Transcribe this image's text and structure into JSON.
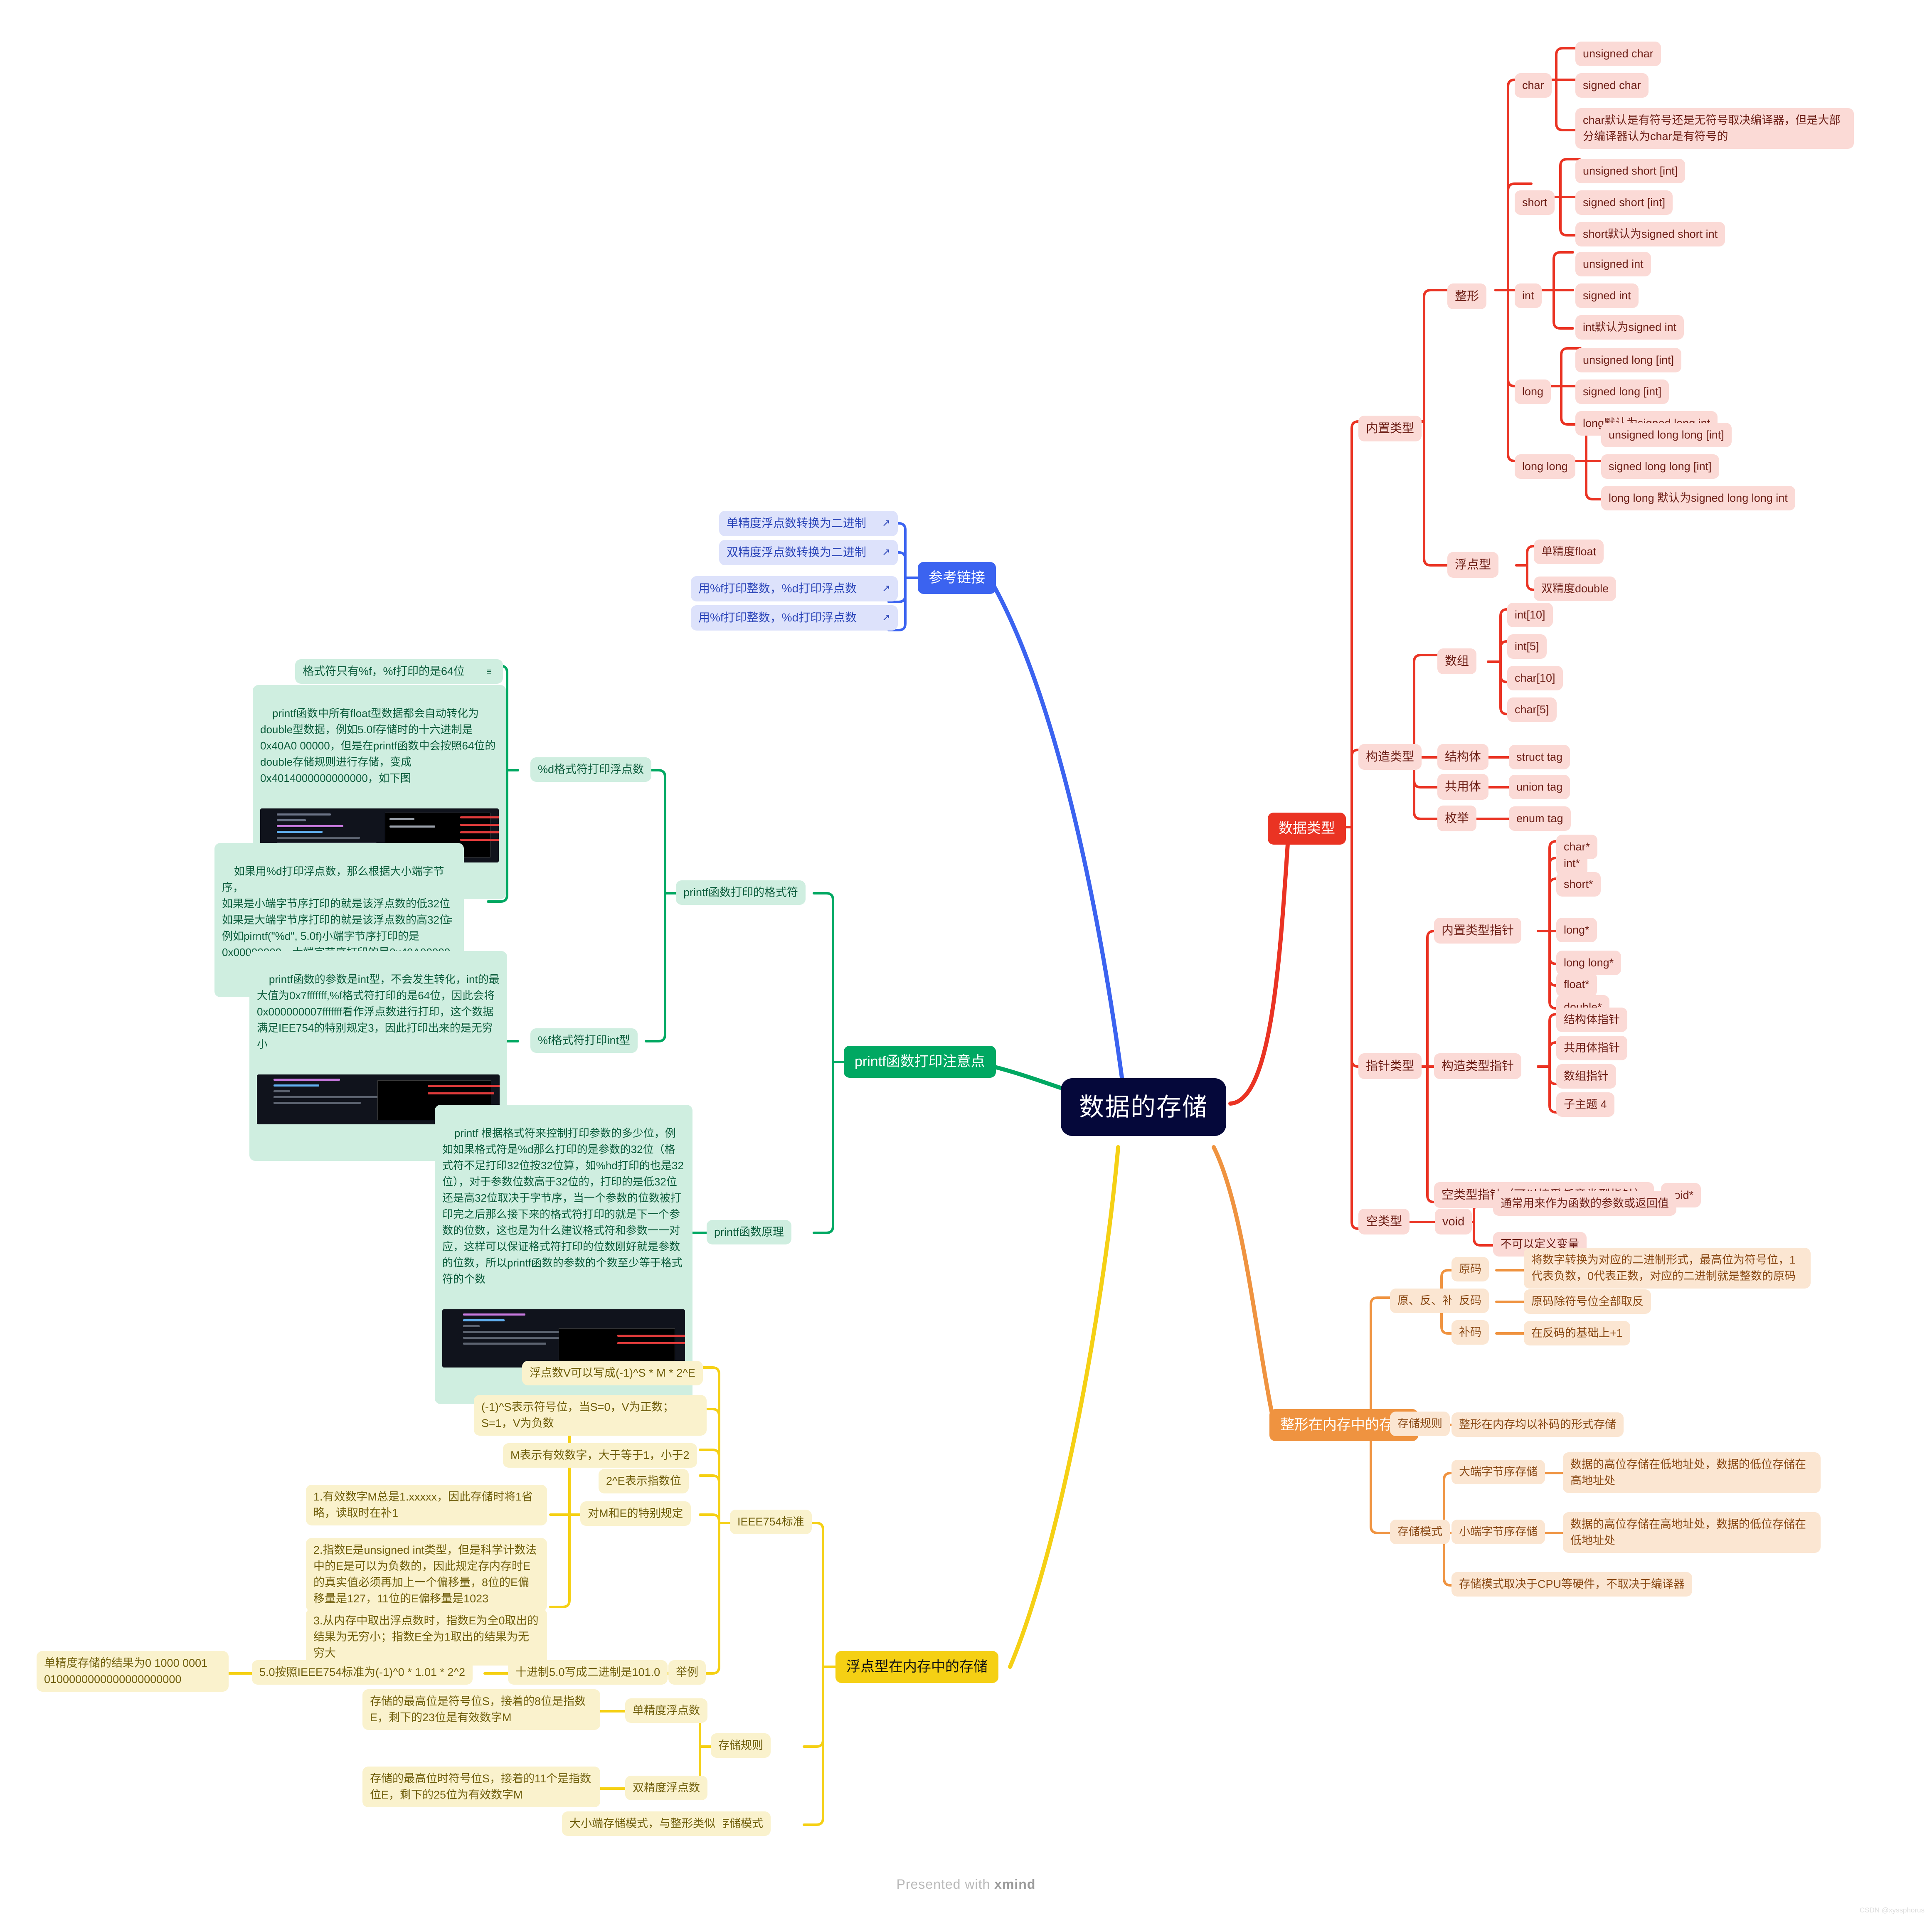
{
  "root": {
    "label": "数据的存储"
  },
  "branches": {
    "data_types": {
      "label": "数据类型",
      "color": "#ea3323",
      "children": {
        "builtin": {
          "label": "内置类型",
          "integer": {
            "label": "整形",
            "char": {
              "label": "char",
              "items": [
                "unsigned char",
                "signed char",
                "char默认是有符号还是无符号取决编译器，但是大部分编译器认为char是有符号的"
              ]
            },
            "short": {
              "label": "short",
              "items": [
                "unsigned short [int]",
                "signed short [int]",
                "short默认为signed short int"
              ]
            },
            "int": {
              "label": "int",
              "items": [
                "unsigned int",
                "signed int",
                "int默认为signed int"
              ]
            },
            "long": {
              "label": "long",
              "items": [
                "unsigned long [int]",
                "signed long [int]",
                "long默认为signed long int"
              ]
            },
            "long_long": {
              "label": "long long",
              "items": [
                "unsigned long long [int]",
                "signed long long [int]",
                "long long 默认为signed long long int"
              ]
            }
          },
          "float_type": {
            "label": "浮点型",
            "items": [
              "单精度float",
              "双精度double"
            ]
          }
        },
        "construct": {
          "label": "构造类型",
          "array": {
            "label": "数组",
            "items": [
              "int[10]",
              "int[5]",
              "char[10]",
              "char[5]"
            ]
          },
          "struct": {
            "label": "结构体",
            "item": "struct tag"
          },
          "union": {
            "label": "共用体",
            "item": "union tag"
          },
          "enum": {
            "label": "枚举",
            "item": "enum tag"
          }
        },
        "pointer": {
          "label": "指针类型",
          "builtin_ptr": {
            "label": "内置类型指针",
            "items": [
              "char*",
              "int*",
              "short*",
              "long*",
              "long long*",
              "float*",
              "double*"
            ]
          },
          "construct_ptr": {
            "label": "构造类型指针",
            "items": [
              "结构体指针",
              "共用体指针",
              "数组指针",
              "子主题 4"
            ]
          },
          "void_ptr": {
            "label": "空类型指针（可以接受任意类型指针）",
            "item": "void*"
          }
        },
        "void_type": {
          "label": "空类型",
          "void": {
            "label": "void",
            "items": [
              "通常用来作为函数的参数或返回值",
              "不可以定义变量"
            ]
          }
        }
      }
    },
    "reference_links": {
      "label": "参考链接",
      "color": "#3b63f0",
      "icon": "external-link-icon",
      "items": [
        "单精度浮点数转换为二进制",
        "双精度浮点数转换为二进制",
        "用%f打印整数，%d打印浮点数",
        "用%f打印整数，%d打印浮点数"
      ]
    },
    "printf_notes": {
      "label": "printf函数打印注意点",
      "color": "#00a862",
      "format_spec": {
        "label": "printf函数打印的格式符",
        "d_float": {
          "label": "%d格式符打印浮点数",
          "notes": [
            "格式符只有%f，%f打印的是64位",
            "printf函数中所有float型数据都会自动转化为double型数据，例如5.0f存储时的十六进制是0x40A0 00000，但是在printf函数中会按照64位的double存储规则进行存储，变成0x4014000000000000，如下图",
            "如果用%d打印浮点数，那么根据大小端字节序，\n如果是小端字节序打印的就是该浮点数的低32位\n如果是大端字节序打印的就是该浮点数的高32位\n例如pirntf(\"%d\", 5.0f)小端字节序打印的是0x00000000，大端字节序打印的是0x40A00000"
          ]
        },
        "f_int": {
          "label": "%f格式符打印int型",
          "note": "printf函数的参数是int型，不会发生转化，int的最大值为0x7fffffff,%f格式符打印的是64位，因此会将0x000000007fffffff看作浮点数进行打印，这个数据满足IEE754的特别规定3，因此打印出来的是无穷小"
        }
      },
      "principle": {
        "label": "printf函数原理",
        "note": "printf 根据格式符来控制打印参数的多少位，例如如果格式符是%d那么打印的是参数的32位（格式符不足打印32位按32位算，如%hd打印的也是32位），对于参数位数高于32位的，打印的是低32位还是高32位取决于字节序，当一个参数的位数被打印完之后那么接下来的格式符打印的就是下一个参数的位数，这也是为什么建议格式符和参数一一对应，这样可以保证格式符打印的位数刚好就是参数的位数，所以printf函数的参数的个数至少等于格式符的个数"
      }
    },
    "int_memory": {
      "label": "整形在内存中的存储",
      "color": "#ef9340",
      "codes": {
        "label": "原、反、补码",
        "items": [
          {
            "name": "原码",
            "desc": "将数字转换为对应的二进制形式，最高位为符号位，1代表负数，0代表正数，对应的二进制就是整数的原码"
          },
          {
            "name": "反码",
            "desc": "原码除符号位全部取反"
          },
          {
            "name": "补码",
            "desc": "在反码的基础上+1"
          }
        ]
      },
      "rule": {
        "label": "存储规则",
        "desc": "整形在内存均以补码的形式存储"
      },
      "mode": {
        "label": "存储模式",
        "items": [
          {
            "name": "大端字节序存储",
            "desc": "数据的高位存储在低地址处，数据的低位存储在高地址处"
          },
          {
            "name": "小端字节序存储",
            "desc": "数据的高位存储在高地址处，数据的低位存储在低地址处"
          }
        ],
        "note": "存储模式取决于CPU等硬件，不取决于编译器"
      }
    },
    "float_memory": {
      "label": "浮点型在内存中的存储",
      "color": "#f5d014",
      "ieee754": {
        "label": "IEEE754标准",
        "items": [
          "浮点数V可以写成(-1)^S * M * 2^E",
          "(-1)^S表示符号位，当S=0，V为正数；S=1，V为负数",
          "M表示有效数字，大于等于1，小于2",
          "2^E表示指数位"
        ],
        "special": {
          "label": "对M和E的特别规定",
          "items": [
            "1.有效数字M总是1.xxxxx，因此存储时将1省略，读取时在补1",
            "2.指数E是unsigned int类型，但是科学计数法中的E是可以为负数的，因此规定存内存时E的真实值必须再加上一个偏移量，8位的E偏移量是127，11位的E偏移量是1023",
            "3.从内存中取出浮点数时，指数E为全0取出的结果为无穷小；指数E全为1取出的结果为无穷大"
          ]
        },
        "example": {
          "label": "举例",
          "chain": [
            "十进制5.0写成二进制是101.0",
            "5.0按照IEEE754标准为(-1)^0 * 1.01 * 2^2",
            "单精度存储的结果为0 1000 0001 0100000000000000000000"
          ]
        }
      },
      "storage_rule": {
        "label": "存储规则",
        "items": [
          {
            "name": "单精度浮点数",
            "desc": "存储的最高位是符号位S，接着的8位是指数E，剩下的23位是有效数字M"
          },
          {
            "name": "双精度浮点数",
            "desc": "存储的最高位时符号位S，接着的11个是指数位E，剩下的25位为有效数字M"
          }
        ]
      },
      "storage_mode": {
        "label": "存储模式",
        "desc": "大小端存储模式，与整形类似"
      }
    }
  },
  "footer": {
    "presented": "Presented with ",
    "brand": "xmind",
    "watermark": "CSDN @xyssphorus"
  }
}
